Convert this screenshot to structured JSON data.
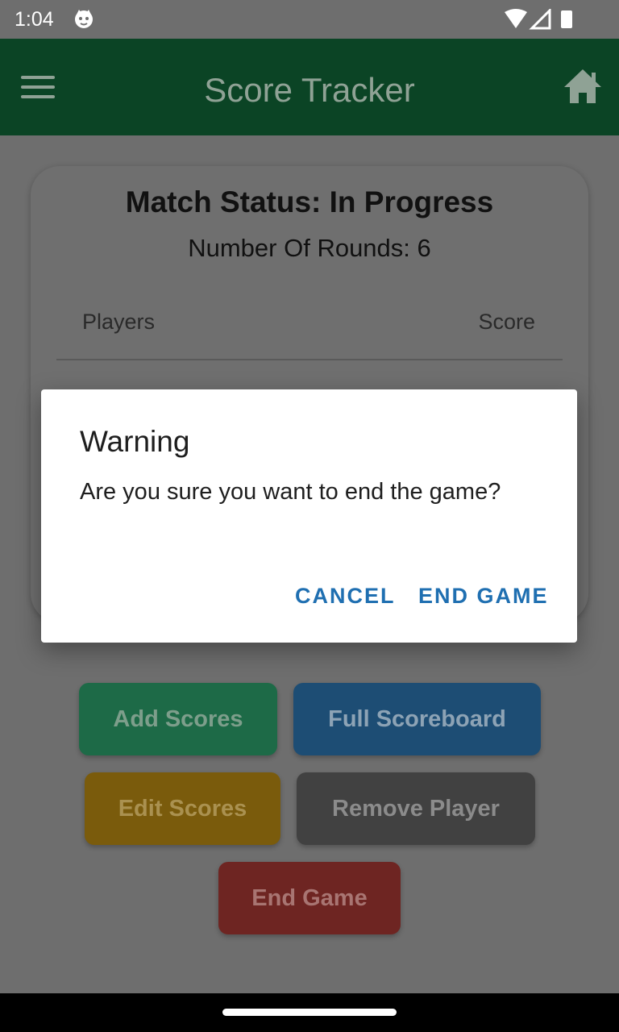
{
  "status_bar": {
    "time": "1:04",
    "icons": [
      "cat-notification-icon",
      "wifi-icon",
      "signal-icon",
      "battery-icon"
    ]
  },
  "app_bar": {
    "title": "Score Tracker",
    "color": "#0b4425",
    "menu_icon": "menu-icon",
    "home_icon": "home-icon"
  },
  "card": {
    "match_status": "Match Status: In Progress",
    "rounds": "Number Of Rounds: 6",
    "table_headers": {
      "players": "Players",
      "score": "Score"
    }
  },
  "actions": {
    "add_scores": "Add Scores",
    "full_scoreboard": "Full Scoreboard",
    "edit_scores": "Edit Scores",
    "remove_player": "Remove Player",
    "end_game": "End Game"
  },
  "dialog": {
    "title": "Warning",
    "message": "Are you sure you want to end the game?",
    "cancel_label": "CANCEL",
    "confirm_label": "END GAME",
    "accent": "#1f6fb1"
  }
}
